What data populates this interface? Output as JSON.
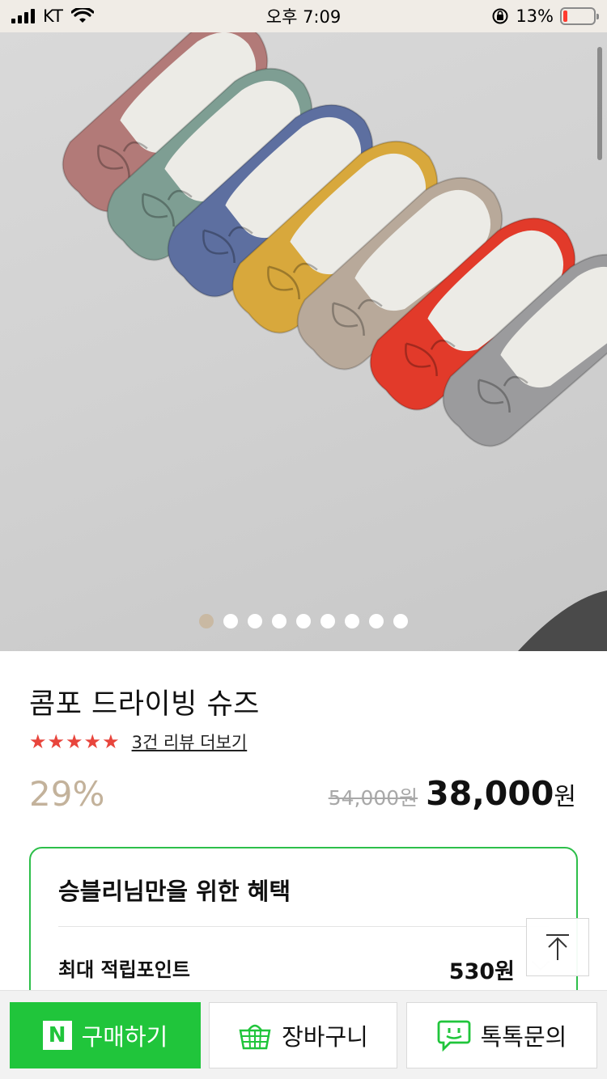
{
  "status_bar": {
    "carrier": "KT",
    "time": "오후 7:09",
    "battery_percent": "13%",
    "battery_level": 0.13
  },
  "gallery": {
    "dot_count": 9,
    "active_index": 0,
    "shoe_colors": [
      "#b27a78",
      "#7e9e93",
      "#5d6fa0",
      "#d8a83c",
      "#b8a99a",
      "#e23a2a",
      "#9b9b9d"
    ]
  },
  "product": {
    "title": "콤포 드라이빙 슈즈",
    "stars": "★★★★★",
    "rating": 5,
    "review_link": "3건 리뷰 더보기",
    "discount": "29%",
    "original_price": "54,000원",
    "sale_price": "38,000",
    "currency": "원"
  },
  "benefit": {
    "title": "승블리님만을 위한 혜택",
    "label": "최대 적립포인트",
    "value": "530원"
  },
  "bottom_bar": {
    "buy_logo": "N",
    "buy_label": "구매하기",
    "cart_label": "장바구니",
    "talk_label": "톡톡문의"
  },
  "colors": {
    "accent_green": "#20c53b",
    "star_red": "#e8453c",
    "discount_beige": "#c3b29b"
  }
}
